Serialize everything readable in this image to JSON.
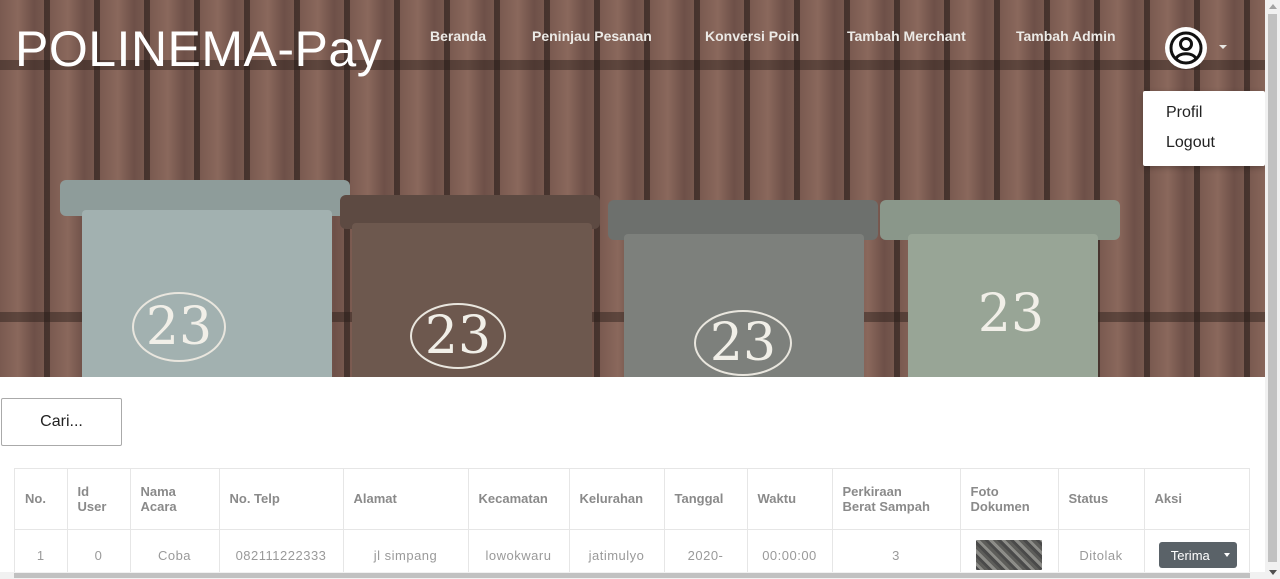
{
  "header": {
    "brand": "POLINEMA-Pay",
    "nav": [
      {
        "label": "Beranda"
      },
      {
        "label": "Peninjau Pesanan"
      },
      {
        "label": "Konversi Poin"
      },
      {
        "label": "Tambah Merchant"
      },
      {
        "label": "Tambah Admin"
      }
    ],
    "avatar_icon": "user-circle-icon",
    "dropdown": {
      "items": [
        {
          "label": "Profil"
        },
        {
          "label": "Logout"
        }
      ]
    },
    "bins": [
      {
        "number": "23"
      },
      {
        "number": "23"
      },
      {
        "number": "23"
      },
      {
        "number": "23"
      }
    ]
  },
  "search": {
    "label": "Cari..."
  },
  "table": {
    "headers": [
      "No.",
      "Id User",
      "Nama Acara",
      "No. Telp",
      "Alamat",
      "Kecamatan",
      "Kelurahan",
      "Tanggal",
      "Waktu",
      "Perkiraan Berat Sampah",
      "Foto Dokumen",
      "Status",
      "Aksi"
    ],
    "rows": [
      {
        "no": "1",
        "id_user": "0",
        "nama_acara": "Coba",
        "no_telp": "082111222333",
        "alamat": "jl simpang",
        "kecamatan": "lowokwaru",
        "kelurahan": "jatimulyo",
        "tanggal": "2020-",
        "waktu": "00:00:00",
        "berat": "3",
        "status": "Ditolak",
        "aksi_label": "Terima"
      }
    ]
  },
  "colors": {
    "brand_text": "#ffffff",
    "nav_text": "#eceae6",
    "action_button": "#5a6268"
  }
}
